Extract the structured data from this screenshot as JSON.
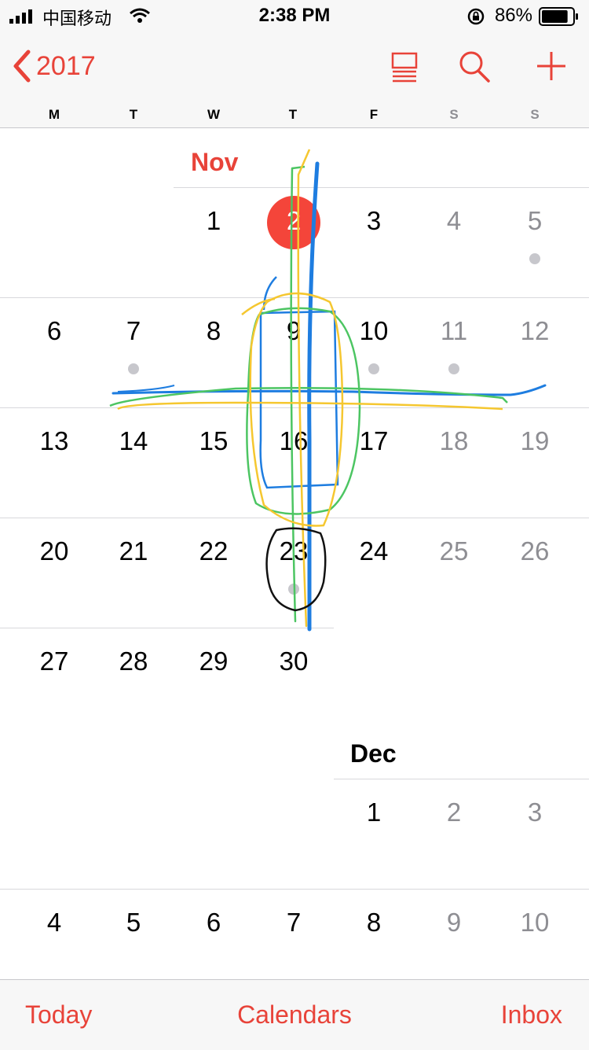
{
  "status_bar": {
    "carrier": "中国移动",
    "time": "2:38 PM",
    "battery_percent": "86%",
    "battery_level": 0.86
  },
  "nav": {
    "back_label": "2017",
    "icons": [
      "list-view-icon",
      "search-icon",
      "add-icon"
    ]
  },
  "weekdays": [
    "M",
    "T",
    "W",
    "T",
    "F",
    "S",
    "S"
  ],
  "november": {
    "label": "Nov",
    "week1": [
      "1",
      "2",
      "3",
      "4",
      "5"
    ],
    "week2": [
      "6",
      "7",
      "8",
      "9",
      "10",
      "11",
      "12"
    ],
    "week3": [
      "13",
      "14",
      "15",
      "16",
      "17",
      "18",
      "19"
    ],
    "week4": [
      "20",
      "21",
      "22",
      "23",
      "24",
      "25",
      "26"
    ],
    "week5": [
      "27",
      "28",
      "29",
      "30"
    ]
  },
  "december": {
    "label": "Dec",
    "week1": [
      "1",
      "2",
      "3"
    ],
    "week2": [
      "4",
      "5",
      "6",
      "7",
      "8",
      "9",
      "10"
    ]
  },
  "colors": {
    "accent": "#e84339",
    "today": "#f4453a",
    "weekend_text": "#8e8e93",
    "event_dot": "#c7c7cc",
    "annotation_blue": "#1e7de0",
    "annotation_green": "#4cc562",
    "annotation_yellow": "#f5c730",
    "annotation_black": "#111111"
  },
  "tab_bar": {
    "today": "Today",
    "calendars": "Calendars",
    "inbox": "Inbox"
  }
}
